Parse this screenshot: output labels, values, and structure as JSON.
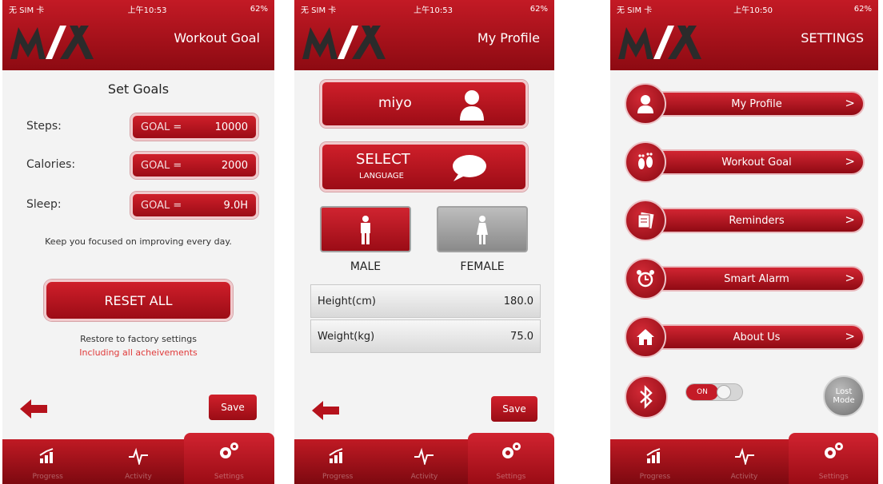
{
  "status": {
    "carrier": "无 SIM 卡",
    "wifi": "◠",
    "battery": "62%"
  },
  "screens": [
    {
      "time": "上午10:53",
      "title": "Workout Goal"
    },
    {
      "time": "上午10:53",
      "title": "My Profile"
    },
    {
      "time": "上午10:50",
      "title": "SETTINGS"
    }
  ],
  "goals": {
    "heading": "Set Goals",
    "rows": [
      {
        "label": "Steps:",
        "key": "GOAL =",
        "value": "10000"
      },
      {
        "label": "Calories:",
        "key": "GOAL =",
        "value": "2000"
      },
      {
        "label": "Sleep:",
        "key": "GOAL =",
        "value": "9.0H"
      }
    ],
    "focus_text": "Keep you focused on improving every day.",
    "reset_label": "RESET ALL",
    "restore_text": "Restore to factory settings",
    "restore_sub": "Including all acheivements",
    "save_label": "Save"
  },
  "profile": {
    "name": "miyo",
    "select_label": "SELECT",
    "language_label": "LANGUAGE",
    "male_label": "MALE",
    "female_label": "FEMALE",
    "height_label": "Height(cm)",
    "height_value": "180.0",
    "weight_label": "Weight(kg)",
    "weight_value": "75.0",
    "save_label": "Save"
  },
  "settings": {
    "items": [
      {
        "label": "My Profile",
        "icon": "person-icon"
      },
      {
        "label": "Workout Goal",
        "icon": "footprints-icon"
      },
      {
        "label": "Reminders",
        "icon": "notes-icon"
      },
      {
        "label": "Smart Alarm",
        "icon": "alarm-clock-icon"
      },
      {
        "label": "About Us",
        "icon": "home-icon"
      }
    ],
    "toggle_label": "ON",
    "lost_mode_label": "Lost Mode"
  },
  "tabs": [
    "Progress",
    "Activity",
    "Settings"
  ],
  "colors": {
    "brand_red": "#c31a25",
    "dark_red": "#8d0a12",
    "text_red": "#e03a3a"
  }
}
